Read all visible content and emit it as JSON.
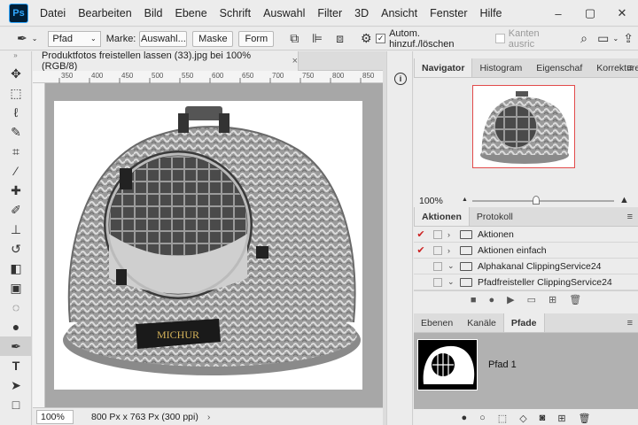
{
  "app": {
    "logo": "Ps"
  },
  "menu": [
    "Datei",
    "Bearbeiten",
    "Bild",
    "Ebene",
    "Schrift",
    "Auswahl",
    "Filter",
    "3D",
    "Ansicht",
    "Fenster",
    "Hilfe"
  ],
  "window_controls": {
    "minimize": "–",
    "maximize": "▢",
    "close": "✕"
  },
  "options": {
    "mode": "Pfad",
    "marke_label": "Marke:",
    "auswahl": "Auswahl...",
    "maske": "Maske",
    "form": "Form",
    "auto_label": "Autom. hinzuf./löschen",
    "kanten_label": "Kanten ausric",
    "auto_checked": true,
    "kanten_checked": false
  },
  "document": {
    "tab_title": "Produktfotos freistellen lassen (33).jpg bei 100% (RGB/8)",
    "close": "×",
    "zoom": "100%",
    "info": "800 Px x 763 Px (300 ppi)",
    "ruler_ticks": [
      "350",
      "400",
      "450",
      "500",
      "550",
      "600",
      "650",
      "700",
      "750",
      "800",
      "850"
    ]
  },
  "navigator": {
    "tabs": [
      "Navigator",
      "Histogram",
      "Eigenschaf",
      "Korrekture"
    ],
    "zoom": "100%"
  },
  "actions": {
    "tabs": [
      "Aktionen",
      "Protokoll"
    ],
    "rows": [
      {
        "label": "Aktionen",
        "checked": true,
        "expanded": false
      },
      {
        "label": "Aktionen einfach",
        "checked": true,
        "expanded": false
      },
      {
        "label": "Alphakanal ClippingService24",
        "checked": false,
        "expanded": true
      },
      {
        "label": "Pfadfreisteller ClippingService24",
        "checked": false,
        "expanded": true
      }
    ]
  },
  "paths": {
    "tabs": [
      "Ebenen",
      "Kanäle",
      "Pfade"
    ],
    "items": [
      {
        "name": "Pfad 1"
      }
    ]
  },
  "product": {
    "brand": "MICHUR"
  },
  "colors": {
    "accent_red": "#e24b4b",
    "panel_bg": "#ececec",
    "selection": "#b1b1b1",
    "ps_blue": "#31a8ff"
  }
}
